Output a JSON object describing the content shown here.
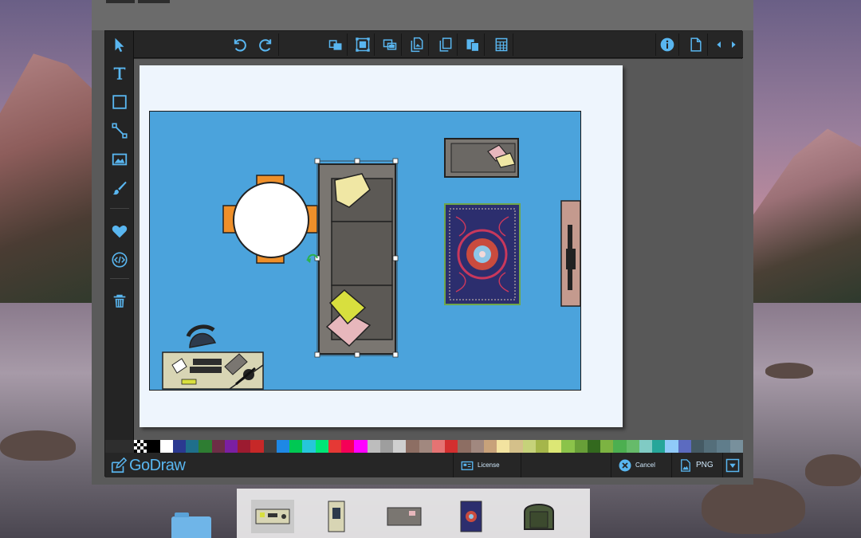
{
  "app": {
    "logo_text": "GoDraw",
    "accent_color": "#59b6f0"
  },
  "toolbar": {
    "buttons": [
      {
        "name": "undo",
        "icon": "undo-icon"
      },
      {
        "name": "redo",
        "icon": "redo-icon"
      },
      {
        "name": "bring-to-front",
        "icon": "layers-front-icon"
      },
      {
        "name": "fit-to-page",
        "icon": "fit-frame-icon"
      },
      {
        "name": "group",
        "icon": "group-icon"
      },
      {
        "name": "copy-image",
        "icon": "copy-image-icon"
      },
      {
        "name": "duplicate",
        "icon": "duplicate-icon"
      },
      {
        "name": "paste",
        "icon": "paste-icon"
      },
      {
        "name": "grid",
        "icon": "grid-icon"
      },
      {
        "name": "info",
        "icon": "info-icon"
      },
      {
        "name": "new-document",
        "icon": "document-icon"
      },
      {
        "name": "collapse-left",
        "icon": "chevron-left-icon"
      },
      {
        "name": "collapse-right",
        "icon": "chevron-right-icon"
      }
    ]
  },
  "tools": [
    {
      "name": "select",
      "icon": "pointer-icon"
    },
    {
      "name": "text",
      "icon": "text-icon"
    },
    {
      "name": "rectangle",
      "icon": "rectangle-icon"
    },
    {
      "name": "connector",
      "icon": "line-icon"
    },
    {
      "name": "image",
      "icon": "image-icon"
    },
    {
      "name": "brush",
      "icon": "brush-icon"
    },
    {
      "name": "favorites",
      "icon": "heart-icon"
    },
    {
      "name": "embed-code",
      "icon": "code-icon"
    },
    {
      "name": "delete",
      "icon": "trash-icon"
    }
  ],
  "palette": [
    "#ffffff",
    "#000000",
    "#ffffff",
    "#2b3990",
    "#1f6f8b",
    "#2e7d32",
    "#6d2e46",
    "#7b1fa2",
    "#9c1b30",
    "#c62828",
    "#404040",
    "#1e88e5",
    "#00c853",
    "#26c6da",
    "#00e676",
    "#e53935",
    "#f50057",
    "#ff00ff",
    "#bdbdbd",
    "#9e9e9e",
    "#cfcfcf",
    "#8d6e63",
    "#a1887f",
    "#e57373",
    "#d32f2f",
    "#8d6e63",
    "#a1887f",
    "#c8a27a",
    "#f3e3a0",
    "#d4c08a",
    "#c6d27a",
    "#a5b64a",
    "#dce775",
    "#8bc34a",
    "#689f38",
    "#33691e",
    "#7cb342",
    "#4caf50",
    "#66bb6a",
    "#80cbc4",
    "#26a69a",
    "#90caf9",
    "#5c6bc0",
    "#455a64",
    "#546e7a",
    "#607d8b",
    "#78909c"
  ],
  "bottombar": {
    "license_label": "License",
    "cancel_label": "Cancel",
    "export_label": "PNG"
  }
}
